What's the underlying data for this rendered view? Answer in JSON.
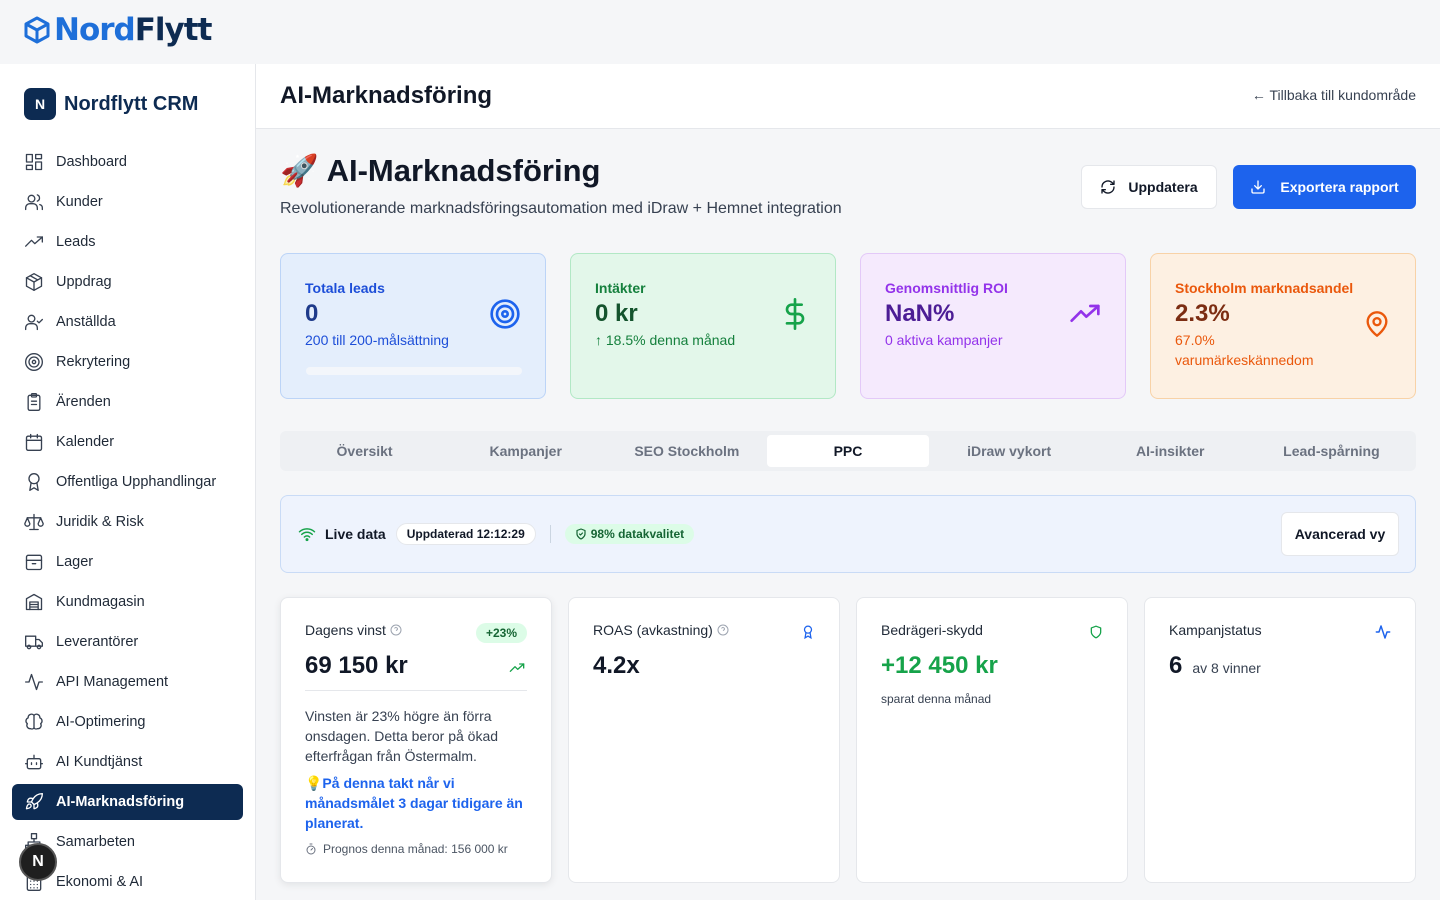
{
  "logo": {
    "part1": "Nord",
    "part2": "Flytt"
  },
  "sidebar": {
    "brand_badge": "N",
    "brand_name": "Nordflytt CRM",
    "items": [
      {
        "label": "Dashboard",
        "icon": "dashboard-icon"
      },
      {
        "label": "Kunder",
        "icon": "users-icon"
      },
      {
        "label": "Leads",
        "icon": "trending-up-icon"
      },
      {
        "label": "Uppdrag",
        "icon": "package-icon"
      },
      {
        "label": "Anställda",
        "icon": "user-check-icon"
      },
      {
        "label": "Rekrytering",
        "icon": "target-icon"
      },
      {
        "label": "Ärenden",
        "icon": "clipboard-icon"
      },
      {
        "label": "Kalender",
        "icon": "calendar-icon"
      },
      {
        "label": "Offentliga Upphandlingar",
        "icon": "award-icon"
      },
      {
        "label": "Juridik & Risk",
        "icon": "scale-icon"
      },
      {
        "label": "Lager",
        "icon": "archive-icon"
      },
      {
        "label": "Kundmagasin",
        "icon": "warehouse-icon"
      },
      {
        "label": "Leverantörer",
        "icon": "truck-icon"
      },
      {
        "label": "API Management",
        "icon": "activity-icon"
      },
      {
        "label": "AI-Optimering",
        "icon": "brain-icon"
      },
      {
        "label": "AI Kundtjänst",
        "icon": "bot-icon"
      },
      {
        "label": "AI-Marknadsföring",
        "icon": "rocket-icon",
        "active": true
      },
      {
        "label": "Samarbeten",
        "icon": "network-icon"
      },
      {
        "label": "Ekonomi & AI",
        "icon": "calculator-icon"
      }
    ],
    "fab_label": "N"
  },
  "header": {
    "title": "AI-Marknadsföring",
    "back_link": "← Tillbaka till kundområde"
  },
  "page": {
    "emoji": "🚀",
    "title": "AI-Marknadsföring",
    "subtitle": "Revolutionerande marknadsföringsautomation med iDraw + Hemnet integration",
    "refresh_label": "Uppdatera",
    "export_label": "Exportera rapport"
  },
  "kpis": [
    {
      "label": "Totala leads",
      "value": "0",
      "sub": "200 till 200-målsättning",
      "icon": "target-icon",
      "progress": 0
    },
    {
      "label": "Intäkter",
      "value": "0 kr",
      "sub": "↑ 18.5% denna månad",
      "icon": "dollar-icon"
    },
    {
      "label": "Genomsnittlig ROI",
      "value": "NaN%",
      "sub": "0 aktiva kampanjer",
      "icon": "trending-up-icon"
    },
    {
      "label": "Stockholm marknadsandel",
      "value": "2.3%",
      "sub": "67.0% varumärkeskännedom",
      "icon": "map-pin-icon"
    }
  ],
  "tabs": [
    {
      "label": "Översikt"
    },
    {
      "label": "Kampanjer"
    },
    {
      "label": "SEO Stockholm"
    },
    {
      "label": "PPC",
      "active": true
    },
    {
      "label": "iDraw vykort"
    },
    {
      "label": "AI-insikter"
    },
    {
      "label": "Lead-spårning"
    }
  ],
  "live": {
    "label": "Live data",
    "updated": "Uppdaterad 12:12:29",
    "quality": "98% datakvalitet",
    "advanced_label": "Avancerad vy"
  },
  "cards": {
    "profit": {
      "title": "Dagens vinst",
      "badge": "+23%",
      "value": "69 150 kr",
      "desc": "Vinsten är 23% högre än förra onsdagen. Detta beror på ökad efterfrågan från Östermalm.",
      "tip": "💡På denna takt når vi månadsmålet 3 dagar tidigare än planerat.",
      "forecast": "Prognos denna månad: 156 000 kr"
    },
    "roas": {
      "title": "ROAS (avkastning)",
      "value": "4.2x"
    },
    "fraud": {
      "title": "Bedrägeri-skydd",
      "value": "+12 450 kr",
      "sub": "sparat denna månad"
    },
    "campaign": {
      "title": "Kampanjstatus",
      "count": "6",
      "text": "av 8 vinner"
    }
  },
  "colors": {
    "brand_navy": "#0d2b52",
    "brand_blue": "#1e6fd9",
    "primary_button": "#1d63ed",
    "success": "#16a34a"
  }
}
